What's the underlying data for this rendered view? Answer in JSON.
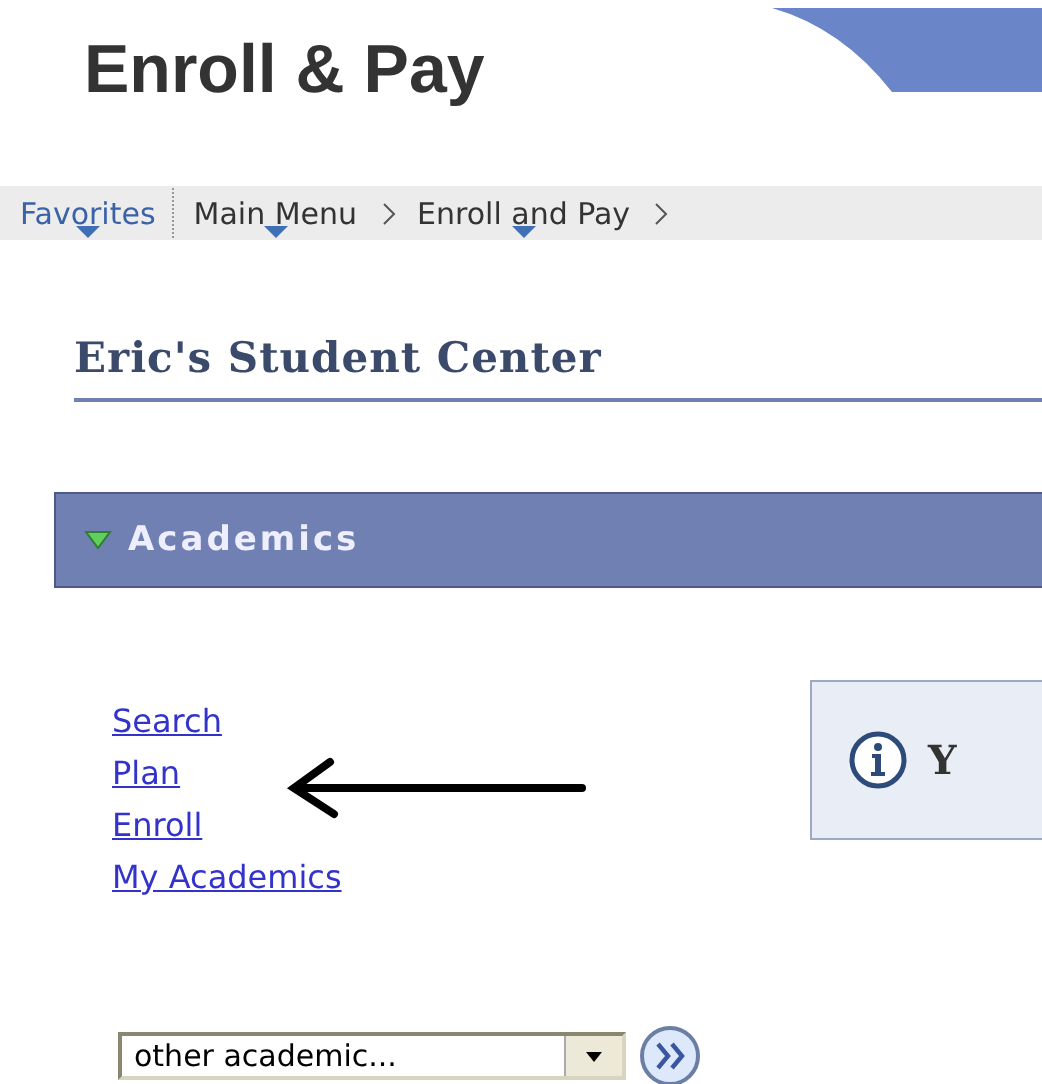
{
  "header": {
    "title": "Enroll & Pay"
  },
  "nav": {
    "items": [
      {
        "label": "Favorites",
        "kind": "menu"
      },
      {
        "label": "Main Menu",
        "kind": "menu"
      },
      {
        "label": "Enroll and Pay",
        "kind": "menu"
      }
    ]
  },
  "page_title": "Eric's Student Center",
  "section": {
    "title": "Academics",
    "expanded": true,
    "links": [
      "Search",
      "Plan",
      "Enroll",
      "My Academics"
    ],
    "info_box": {
      "text": "Y"
    },
    "dropdown": {
      "value": "other academic..."
    }
  }
}
